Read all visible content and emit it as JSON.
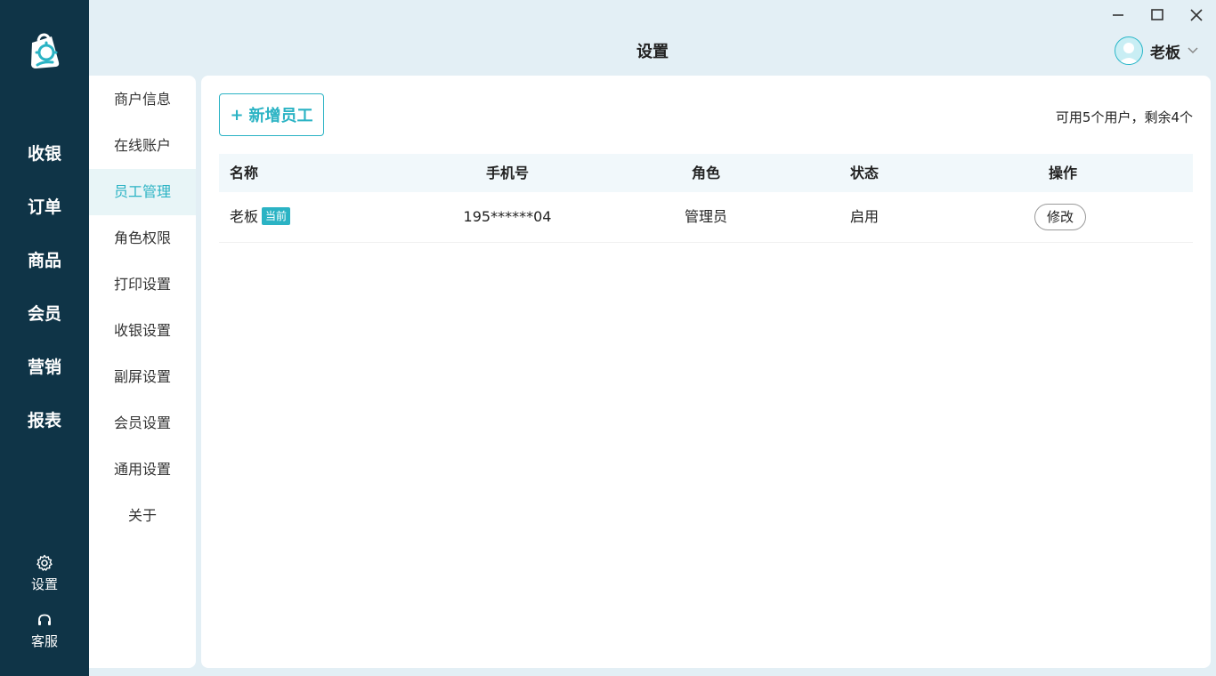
{
  "window": {
    "title": "设置",
    "controls": [
      "minimize-icon",
      "maximize-icon",
      "close-icon"
    ]
  },
  "user": {
    "name": "老板"
  },
  "nav": {
    "items": [
      "收银",
      "订单",
      "商品",
      "会员",
      "营销",
      "报表"
    ],
    "settings_label": "设置",
    "service_label": "客服"
  },
  "submenu": {
    "items": [
      "商户信息",
      "在线账户",
      "员工管理",
      "角色权限",
      "打印设置",
      "收银设置",
      "副屏设置",
      "会员设置",
      "通用设置",
      "关于"
    ],
    "active": "员工管理"
  },
  "main": {
    "add_button": "新增员工",
    "add_icon": "+",
    "quota": "可用5个用户，剩余4个",
    "columns": [
      "名称",
      "手机号",
      "角色",
      "状态",
      "操作"
    ],
    "rows": [
      {
        "name": "老板",
        "badge": "当前",
        "phone": "195******04",
        "role": "管理员",
        "status": "启用",
        "action": "修改"
      }
    ]
  },
  "colors": {
    "accent": "#2bb3c4",
    "sidebar": "#0f3447",
    "background": "#e3eff5"
  }
}
